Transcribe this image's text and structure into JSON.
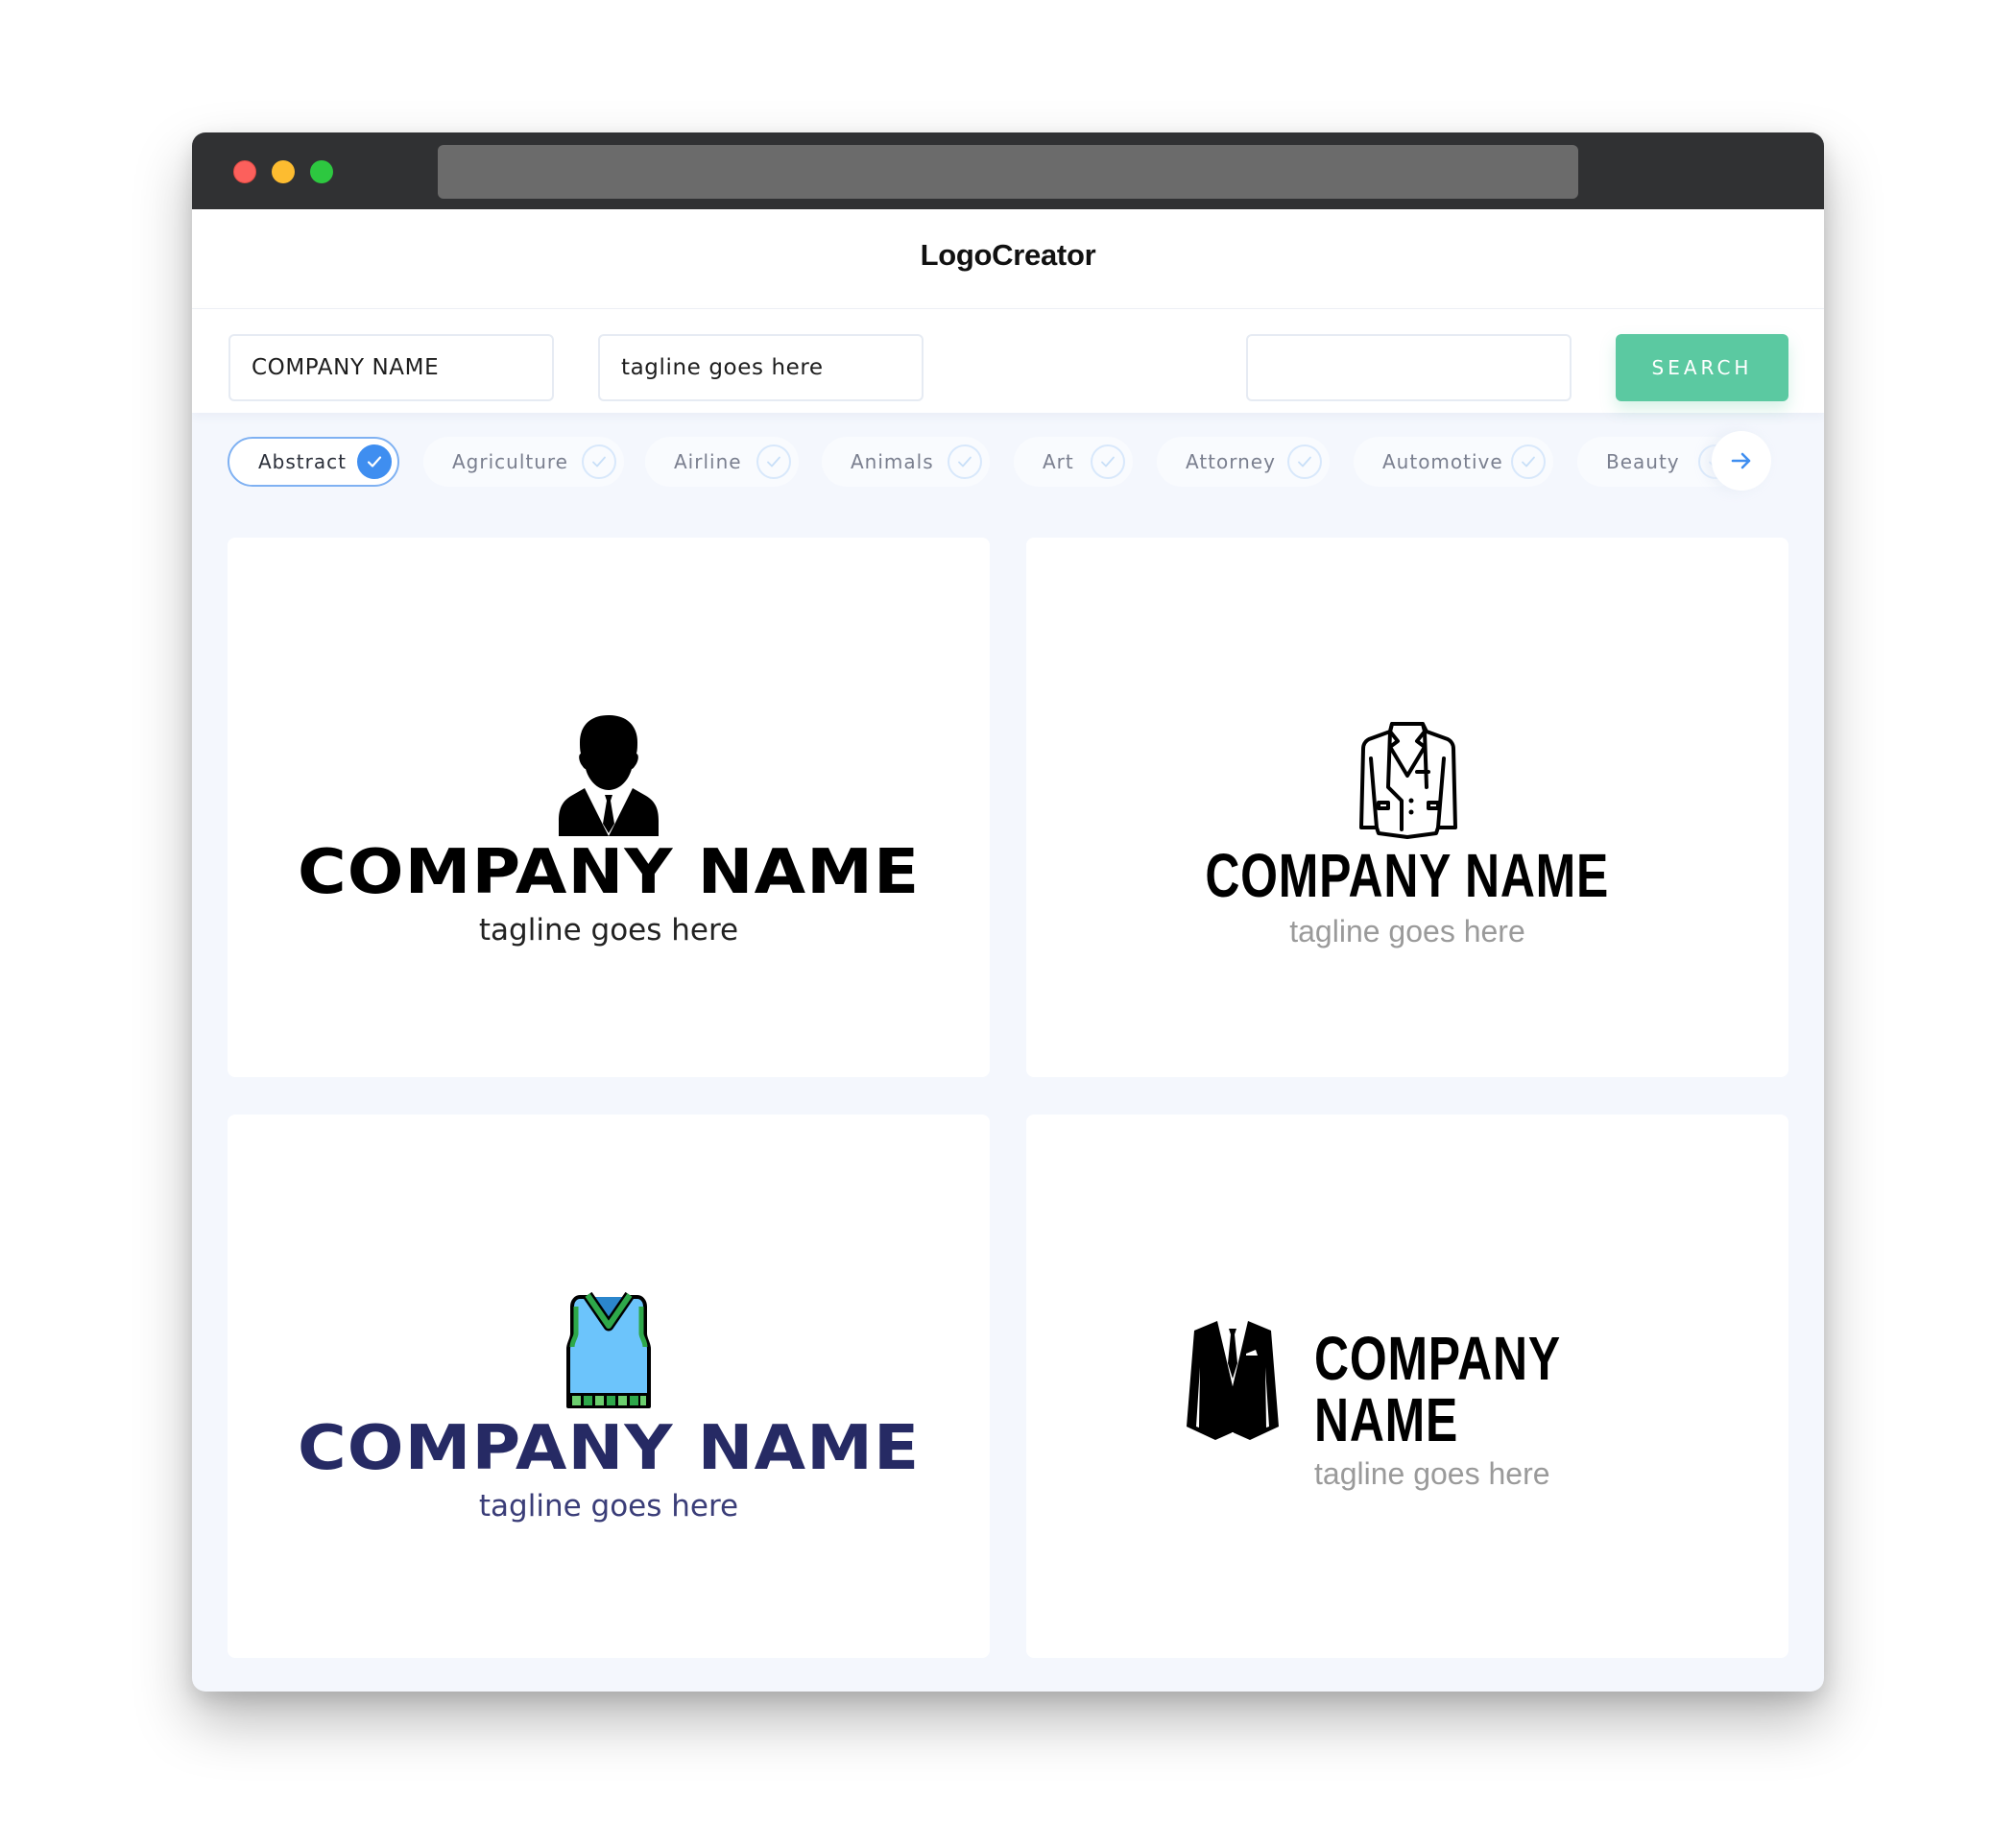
{
  "app": {
    "brand": "LogoCreator"
  },
  "search": {
    "company_name_value": "COMPANY NAME",
    "tagline_value": "tagline goes here",
    "keyword_value": "",
    "button_label": "SEARCH"
  },
  "categories": {
    "items": [
      {
        "label": "Abstract",
        "selected": true
      },
      {
        "label": "Agriculture",
        "selected": false
      },
      {
        "label": "Airline",
        "selected": false
      },
      {
        "label": "Animals",
        "selected": false
      },
      {
        "label": "Art",
        "selected": false
      },
      {
        "label": "Attorney",
        "selected": false
      },
      {
        "label": "Automotive",
        "selected": false
      },
      {
        "label": "Beauty",
        "selected": false
      }
    ],
    "next_icon": "arrow-right-icon"
  },
  "logos": [
    {
      "company": "COMPANY NAME",
      "tagline": "tagline goes here",
      "icon": "businessman-icon",
      "name_color": "#000000",
      "tagline_color": "#222222"
    },
    {
      "company": "COMPANY NAME",
      "tagline": "tagline goes here",
      "icon": "blazer-outline-icon",
      "name_color": "#000000",
      "tagline_color": "#9a9a9a"
    },
    {
      "company": "COMPANY NAME",
      "tagline": "tagline goes here",
      "icon": "sweater-vest-icon",
      "name_color": "#262a64",
      "tagline_color": "#3a3d78"
    },
    {
      "company": "COMPANY NAME",
      "tagline": "tagline goes here",
      "icon": "suit-jacket-icon",
      "name_color": "#000000",
      "tagline_color": "#9a9a9a"
    }
  ],
  "colors": {
    "accent_green": "#5bc9a1",
    "accent_blue": "#3f8ef0",
    "titlebar": "#303133",
    "vest_blue": "#6cc4fb",
    "vest_green": "#2ea84a"
  }
}
